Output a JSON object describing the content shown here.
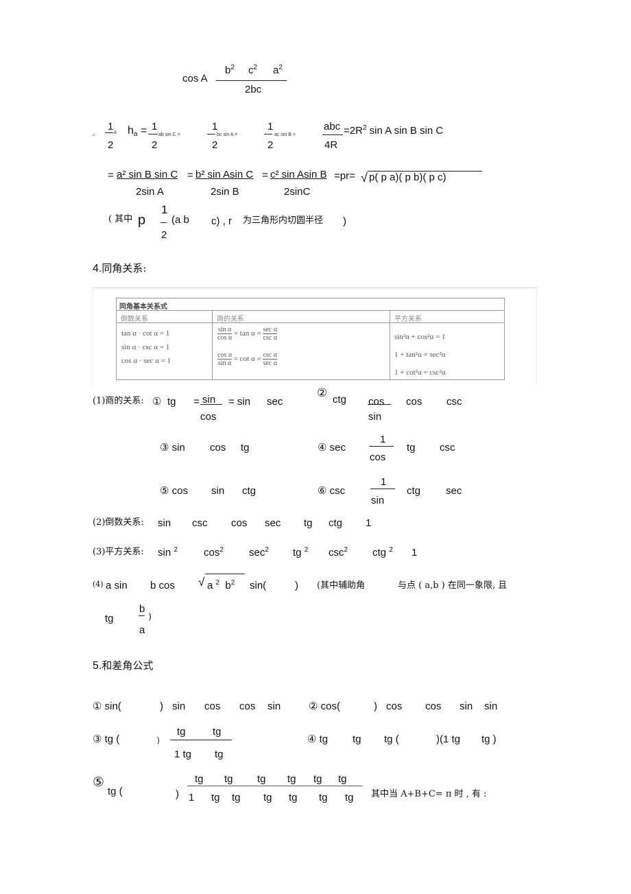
{
  "document": {
    "cosine_law": {
      "lhs": "cos A",
      "numerator": [
        "b",
        "c",
        "a"
      ],
      "exponent": "2",
      "denominator": "2bc"
    },
    "area": {
      "prefix_mark": "⊿",
      "half_num": "1",
      "half_den": "2",
      "term_a": "a",
      "h_a": "h",
      "h_sub": "a",
      "eq": "=",
      "t1": "ab sin C =",
      "t2": "bc sin A =",
      "t3": "ac sin B =",
      "abc_num": "abc",
      "abc_den": "4R",
      "rhs": "=2R",
      "rhs_exp": "2",
      "rhs_tail": "sin A sin B sin C"
    },
    "area2": {
      "f1_num": "a² sin B sin C",
      "f1_den": "2sin A",
      "f2_num": "b² sin Asin C",
      "f2_den": "2sin B",
      "f3_num": "c² sin Asin B",
      "f3_den": "2sinC",
      "eq": "=",
      "pr": "=pr=",
      "sqrt_body": "p( p  a)( p  b)( p  c)"
    },
    "note": {
      "open": "( 其中",
      "p": "p",
      "half_num": "1",
      "half_den": "2",
      "paren": "(a  b",
      "tail": "c) , r",
      "desc": "为三角形内切圆半径",
      "close": ")"
    },
    "section4": {
      "heading_num": "4.",
      "heading_text": "同角关系:"
    },
    "table": {
      "title": "同角基本关系式",
      "col_headers": [
        "倒数关系",
        "商的关系",
        "平方关系"
      ],
      "reciprocal": [
        "tan α · cot α = 1",
        "sin α · csc α = 1",
        "cos α · sec α = 1"
      ],
      "quotient": [
        {
          "l_num": "sin α",
          "l_den": "cos α",
          "mid": "= tan α =",
          "r_num": "sec α",
          "r_den": "csc α"
        },
        {
          "l_num": "cos α",
          "l_den": "sin α",
          "mid": "= cot α =",
          "r_num": "csc α",
          "r_den": "sec α"
        }
      ],
      "square": [
        "sin²α + cos²α = 1",
        "1 + tan²α = sec²α",
        "1 + cot²α = csc²α"
      ]
    },
    "quotient_rel": {
      "label": "(1)商的关系:",
      "c1": "①",
      "tg": "tg",
      "eq": "=",
      "sin": "sin",
      "cos": "cos",
      "eq_sin": "= sin",
      "sec": "sec",
      "c2": "②",
      "ctg": "ctg",
      "cos_b": "cos",
      "csc": "csc"
    },
    "rows_3_6": {
      "r3": [
        "③ sin",
        "cos",
        "tg"
      ],
      "r4": [
        "④ sec",
        "1",
        "cos",
        "tg",
        "csc"
      ],
      "r5": [
        "⑤ cos",
        "sin",
        "ctg"
      ],
      "r6": [
        "⑥ csc",
        "1",
        "sin",
        "ctg",
        "sec"
      ]
    },
    "reciprocal_rel": {
      "label": "(2)倒数关系:",
      "terms": [
        "sin",
        "csc",
        "cos",
        "sec",
        "tg",
        "ctg",
        "1"
      ]
    },
    "square_rel": {
      "label": "(3)平方关系:",
      "terms": [
        "sin",
        "cos",
        "sec",
        "tg",
        "csc",
        "ctg",
        "1"
      ],
      "exp": "2"
    },
    "aux_angle": {
      "label": "(4)",
      "t1": "a sin",
      "t2": "b cos",
      "sqrt_body_a": "a",
      "sqrt_body_b": "b",
      "exp": "2",
      "sin_open": "sin(",
      "close": ")",
      "note1": "(其中辅助角",
      "note2": "与点 ( a,b ) 在同一象限, 且",
      "tg": "tg",
      "frac_num": "b",
      "frac_den": "a",
      "end": ")"
    },
    "section5": {
      "heading_num": "5.",
      "heading_text": "和差角公式"
    },
    "sum_diff": {
      "f1": [
        "① sin(",
        ")",
        "sin",
        "cos",
        "cos",
        "sin"
      ],
      "f2": [
        "② cos(",
        ")",
        "cos",
        "cos",
        "sin",
        "sin"
      ],
      "f3_lhs": [
        "③ tg (",
        ")"
      ],
      "f3_num": [
        "tg",
        "tg"
      ],
      "f3_den": [
        "1  tg",
        "tg"
      ],
      "f4": [
        "④ tg",
        "tg",
        "tg (",
        ")(1  tg",
        "tg  )"
      ],
      "f5_circle": "⑤",
      "f5_lhs": [
        "tg (",
        ")"
      ],
      "f5_num": [
        "tg",
        "tg",
        "tg",
        "tg",
        "tg",
        "tg"
      ],
      "f5_den": [
        "1",
        "tg",
        "tg",
        "tg",
        "tg",
        "tg",
        "tg"
      ],
      "f5_note": "其中当 A+B+C= π 时 , 有 :"
    }
  }
}
